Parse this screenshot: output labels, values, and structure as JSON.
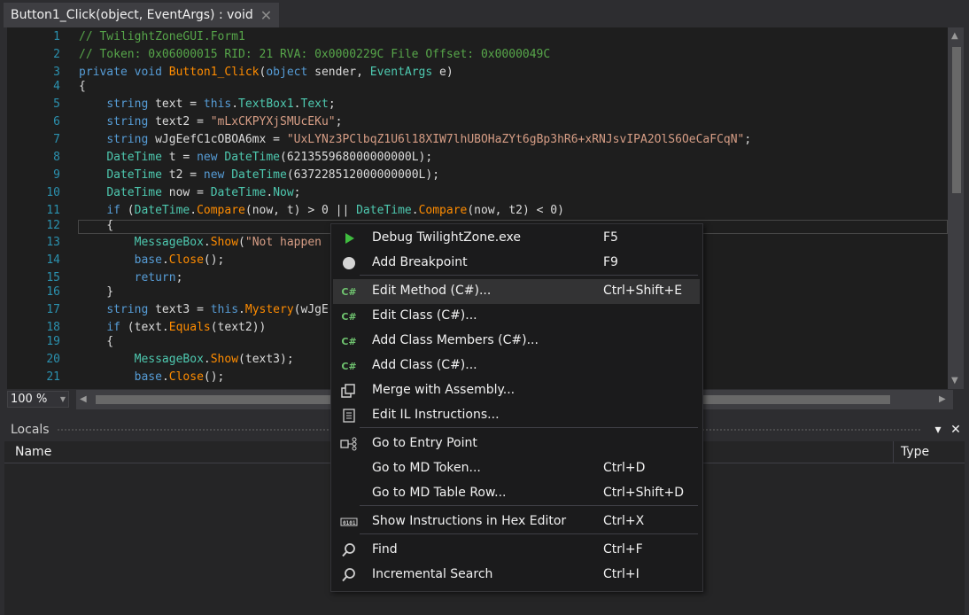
{
  "tab": {
    "title": "Button1_Click(object, EventArgs) : void",
    "close": "✕"
  },
  "editor": {
    "lines": [
      {
        "n": "1",
        "tokens": [
          [
            "cm",
            "// TwilightZoneGUI.Form1"
          ]
        ]
      },
      {
        "n": "2",
        "tokens": [
          [
            "cm",
            "// Token: 0x06000015 RID: 21 RVA: 0x0000229C File Offset: 0x0000049C"
          ]
        ]
      },
      {
        "n": "3",
        "tokens": [
          [
            "kw",
            "private "
          ],
          [
            "kw",
            "void "
          ],
          [
            "fn",
            "Button1_Click"
          ],
          [
            "id",
            "("
          ],
          [
            "kw",
            "object "
          ],
          [
            "id",
            "sender, "
          ],
          [
            "ty",
            "EventArgs "
          ],
          [
            "id",
            "e)"
          ]
        ]
      },
      {
        "n": "4",
        "tokens": [
          [
            "id",
            "{"
          ]
        ]
      },
      {
        "n": "5",
        "tokens": [
          [
            "id",
            "    "
          ],
          [
            "kw",
            "string "
          ],
          [
            "id",
            "text = "
          ],
          [
            "kw",
            "this"
          ],
          [
            "id",
            "."
          ],
          [
            "ty",
            "TextBox1"
          ],
          [
            "id",
            "."
          ],
          [
            "ty",
            "Text"
          ],
          [
            "id",
            ";"
          ]
        ]
      },
      {
        "n": "6",
        "tokens": [
          [
            "id",
            "    "
          ],
          [
            "kw",
            "string "
          ],
          [
            "id",
            "text2 = "
          ],
          [
            "st",
            "\"mLxCKPYXjSMUcEKu\""
          ],
          [
            "id",
            ";"
          ]
        ]
      },
      {
        "n": "7",
        "tokens": [
          [
            "id",
            "    "
          ],
          [
            "kw",
            "string "
          ],
          [
            "id",
            "wJgEefC1cOBOA6mx = "
          ],
          [
            "st",
            "\"UxLYNz3PClbqZ1U6l18XIW7lhUBOHaZYt6gBp3hR6+xRNJsvIPA2OlS6OeCaFCqN\""
          ],
          [
            "id",
            ";"
          ]
        ]
      },
      {
        "n": "8",
        "tokens": [
          [
            "id",
            "    "
          ],
          [
            "ty",
            "DateTime "
          ],
          [
            "id",
            "t = "
          ],
          [
            "kw",
            "new "
          ],
          [
            "ty",
            "DateTime"
          ],
          [
            "id",
            "(621355968000000000L);"
          ]
        ]
      },
      {
        "n": "9",
        "tokens": [
          [
            "id",
            "    "
          ],
          [
            "ty",
            "DateTime "
          ],
          [
            "id",
            "t2 = "
          ],
          [
            "kw",
            "new "
          ],
          [
            "ty",
            "DateTime"
          ],
          [
            "id",
            "(637228512000000000L);"
          ]
        ]
      },
      {
        "n": "10",
        "tokens": [
          [
            "id",
            "    "
          ],
          [
            "ty",
            "DateTime "
          ],
          [
            "id",
            "now = "
          ],
          [
            "ty",
            "DateTime"
          ],
          [
            "id",
            "."
          ],
          [
            "ty",
            "Now"
          ],
          [
            "id",
            ";"
          ]
        ]
      },
      {
        "n": "11",
        "tokens": [
          [
            "id",
            "    "
          ],
          [
            "kw",
            "if "
          ],
          [
            "id",
            "("
          ],
          [
            "ty",
            "DateTime"
          ],
          [
            "id",
            "."
          ],
          [
            "fn",
            "Compare"
          ],
          [
            "id",
            "(now, t) > 0 || "
          ],
          [
            "ty",
            "DateTime"
          ],
          [
            "id",
            "."
          ],
          [
            "fn",
            "Compare"
          ],
          [
            "id",
            "(now, t2) < 0)"
          ]
        ]
      },
      {
        "n": "12",
        "tokens": [
          [
            "id",
            "    {"
          ]
        ]
      },
      {
        "n": "13",
        "tokens": [
          [
            "id",
            "        "
          ],
          [
            "ty",
            "MessageBox"
          ],
          [
            "id",
            "."
          ],
          [
            "fn",
            "Show"
          ],
          [
            "id",
            "("
          ],
          [
            "st",
            "\"Not happen"
          ]
        ]
      },
      {
        "n": "14",
        "tokens": [
          [
            "id",
            "        "
          ],
          [
            "kw",
            "base"
          ],
          [
            "id",
            "."
          ],
          [
            "fn",
            "Close"
          ],
          [
            "id",
            "();"
          ]
        ]
      },
      {
        "n": "15",
        "tokens": [
          [
            "id",
            "        "
          ],
          [
            "kw",
            "return"
          ],
          [
            "id",
            ";"
          ]
        ]
      },
      {
        "n": "16",
        "tokens": [
          [
            "id",
            "    }"
          ]
        ]
      },
      {
        "n": "17",
        "tokens": [
          [
            "id",
            "    "
          ],
          [
            "kw",
            "string "
          ],
          [
            "id",
            "text3 = "
          ],
          [
            "kw",
            "this"
          ],
          [
            "id",
            "."
          ],
          [
            "fn",
            "Mystery"
          ],
          [
            "id",
            "(wJgE"
          ]
        ]
      },
      {
        "n": "18",
        "tokens": [
          [
            "id",
            "    "
          ],
          [
            "kw",
            "if "
          ],
          [
            "id",
            "(text."
          ],
          [
            "fn",
            "Equals"
          ],
          [
            "id",
            "(text2))"
          ]
        ]
      },
      {
        "n": "19",
        "tokens": [
          [
            "id",
            "    {"
          ]
        ]
      },
      {
        "n": "20",
        "tokens": [
          [
            "id",
            "        "
          ],
          [
            "ty",
            "MessageBox"
          ],
          [
            "id",
            "."
          ],
          [
            "fn",
            "Show"
          ],
          [
            "id",
            "(text3);"
          ]
        ]
      },
      {
        "n": "21",
        "tokens": [
          [
            "id",
            "        "
          ],
          [
            "kw",
            "base"
          ],
          [
            "id",
            "."
          ],
          [
            "fn",
            "Close"
          ],
          [
            "id",
            "();"
          ]
        ]
      }
    ]
  },
  "zoom": {
    "value": "100 %"
  },
  "locals": {
    "title": "Locals",
    "col_name": "Name",
    "col_type": "Type",
    "dropdown_icon": "▾",
    "close_icon": "✕"
  },
  "menu": {
    "items": [
      {
        "label": "Debug TwilightZone.exe",
        "shortcut": "F5",
        "icon": "play-icon"
      },
      {
        "label": "Add Breakpoint",
        "shortcut": "F9",
        "icon": "breakpoint-icon"
      },
      {
        "label": "Edit Method (C#)...",
        "shortcut": "Ctrl+Shift+E",
        "icon": "csharp-icon",
        "highlight": true
      },
      {
        "label": "Edit Class (C#)...",
        "shortcut": "",
        "icon": "csharp-icon"
      },
      {
        "label": "Add Class Members (C#)...",
        "shortcut": "",
        "icon": "csharp-icon"
      },
      {
        "label": "Add Class (C#)...",
        "shortcut": "",
        "icon": "csharp-icon"
      },
      {
        "label": "Merge with Assembly...",
        "shortcut": "",
        "icon": "merge-icon"
      },
      {
        "label": "Edit IL Instructions...",
        "shortcut": "",
        "icon": "il-icon"
      },
      {
        "label": "Go to Entry Point",
        "shortcut": "",
        "icon": "entry-point-icon"
      },
      {
        "label": "Go to MD Token...",
        "shortcut": "Ctrl+D",
        "icon": ""
      },
      {
        "label": "Go to MD Table Row...",
        "shortcut": "Ctrl+Shift+D",
        "icon": ""
      },
      {
        "label": "Show Instructions in Hex Editor",
        "shortcut": "Ctrl+X",
        "icon": "hex-icon"
      },
      {
        "label": "Find",
        "shortcut": "Ctrl+F",
        "icon": "search-icon"
      },
      {
        "label": "Incremental Search",
        "shortcut": "Ctrl+I",
        "icon": "search-icon"
      }
    ],
    "csharp_glyph": "C#"
  },
  "colors": {
    "accent_play": "#3fbc3f",
    "line_numbers": "#2b91af"
  }
}
